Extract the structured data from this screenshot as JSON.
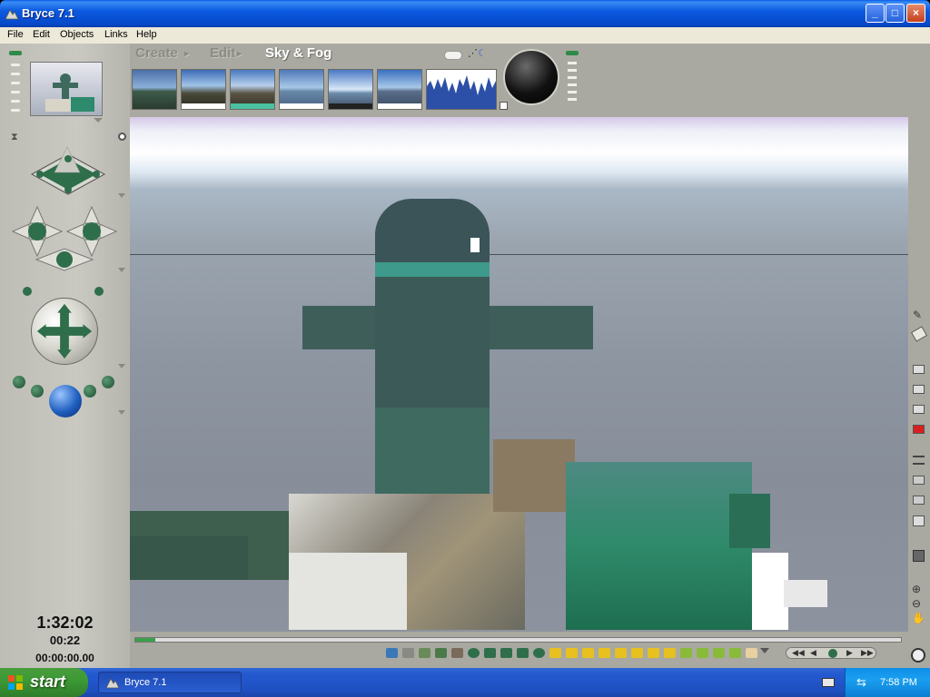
{
  "window": {
    "title": "Bryce 7.1",
    "buttons": [
      "minimize",
      "maximize",
      "close"
    ]
  },
  "menu": [
    "File",
    "Edit",
    "Objects",
    "Links",
    "Help"
  ],
  "palette_tabs": {
    "create": "Create",
    "edit": "Edit",
    "sky_fog": "Sky & Fog"
  },
  "sky_presets": [
    {
      "name": "sky-preset-1"
    },
    {
      "name": "sky-preset-2"
    },
    {
      "name": "sky-preset-3"
    },
    {
      "name": "sky-preset-4"
    },
    {
      "name": "sky-preset-5"
    },
    {
      "name": "sky-preset-6"
    },
    {
      "name": "cloud-histogram"
    }
  ],
  "time": {
    "clock": "1:32:02",
    "duration": "00:22",
    "timecode": "00:00:00.00"
  },
  "taskbar": {
    "start_label": "start",
    "task_label": "Bryce 7.1",
    "clock": "7:58 PM"
  },
  "colors": {
    "titlebar": "#0b5ae0",
    "panel": "#a9a9a1",
    "accent_green": "#2f6e4a",
    "accent_blue": "#2060c0"
  }
}
